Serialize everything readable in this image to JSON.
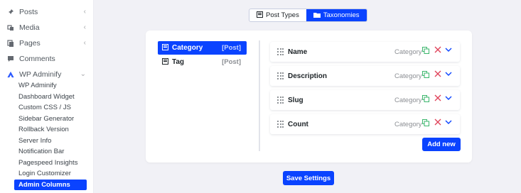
{
  "sidebar": {
    "items": [
      {
        "label": "Posts",
        "icon": "pin-icon"
      },
      {
        "label": "Media",
        "icon": "media-icon"
      },
      {
        "label": "Pages",
        "icon": "pages-icon"
      },
      {
        "label": "Comments",
        "icon": "comments-icon"
      },
      {
        "label": "WP Adminify",
        "icon": "adminify-icon"
      }
    ],
    "submenu": [
      "WP Adminify",
      "Dashboard Widget",
      "Custom CSS / JS",
      "Sidebar Generator",
      "Rollback Version",
      "Server Info",
      "Notification Bar",
      "Pagespeed Insights",
      "Login Customizer",
      "Admin Columns"
    ],
    "active_submenu": "Admin Columns"
  },
  "toggle": {
    "post_types": "Post Types",
    "taxonomies": "Taxonomies",
    "active": "Taxonomies"
  },
  "taxonomies": [
    {
      "name": "Category",
      "type": "[Post]",
      "active": true
    },
    {
      "name": "Tag",
      "type": "[Post]",
      "active": false
    }
  ],
  "columns": [
    {
      "name": "Name",
      "taxonomy": "Category"
    },
    {
      "name": "Description",
      "taxonomy": "Category"
    },
    {
      "name": "Slug",
      "taxonomy": "Category"
    },
    {
      "name": "Count",
      "taxonomy": "Category"
    }
  ],
  "buttons": {
    "add_new": "Add new",
    "save_settings": "Save Settings"
  },
  "colors": {
    "accent": "#0a43ff",
    "copy_icon": "#3ab56b",
    "delete_icon": "#e0455b"
  }
}
